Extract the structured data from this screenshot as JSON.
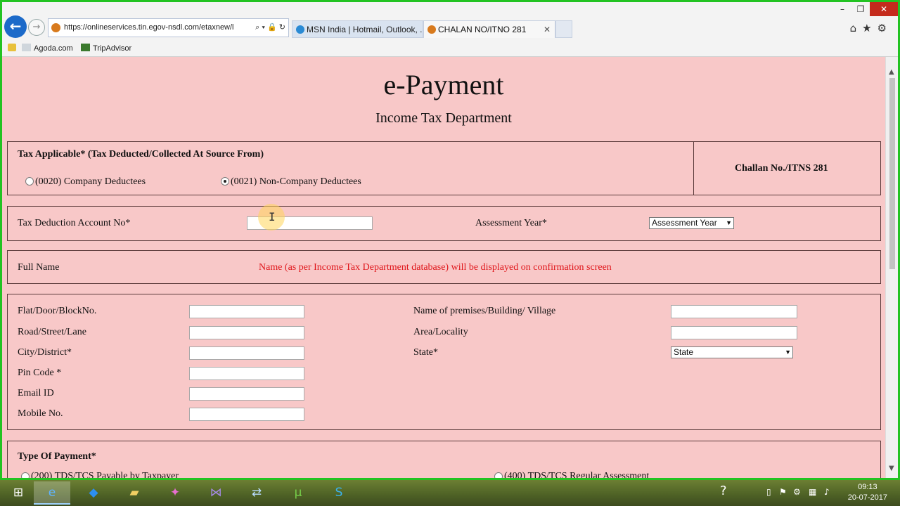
{
  "browser": {
    "address_url": "https://onlineservices.tin.egov-nsdl.com/etaxnew/l",
    "address_icons": "⌕ ▾ 🔒 ↻",
    "tabs": [
      {
        "label": "MSN India | Hotmail, Outlook, ..."
      },
      {
        "label": "CHALAN NO/ITNO 281"
      }
    ],
    "tab_close": "✕",
    "window_controls": {
      "minimize": "–",
      "restore": "❐",
      "close": "✕"
    },
    "right_icons": "⌂★⚙",
    "favorites": [
      {
        "label": "Agoda.com",
        "icon": "agoda-icon"
      },
      {
        "label": "TripAdvisor",
        "icon": "tripadvisor-icon"
      }
    ]
  },
  "page": {
    "title": "e-Payment",
    "subtitle": "Income Tax Department",
    "tax_applicable": {
      "heading": "Tax Applicable* (Tax Deducted/Collected At Source From)",
      "options": [
        {
          "label": "(0020) Company Deductees",
          "selected": false
        },
        {
          "label": "(0021) Non-Company Deductees",
          "selected": true
        }
      ],
      "challan": "Challan No./ITNS 281"
    },
    "tan": {
      "label": "Tax Deduction Account No*",
      "value": "",
      "assessment_label": "Assessment Year*",
      "assessment_value": "Assessment Year"
    },
    "full_name": {
      "label": "Full Name",
      "notice": "Name (as per Income Tax Department database) will be displayed on confirmation screen"
    },
    "address": {
      "left": [
        {
          "label": "Flat/Door/BlockNo.",
          "value": ""
        },
        {
          "label": "Road/Street/Lane",
          "value": ""
        },
        {
          "label": "City/District*",
          "value": ""
        },
        {
          "label": "Pin Code *",
          "value": ""
        },
        {
          "label": "Email ID",
          "value": ""
        },
        {
          "label": "Mobile No.",
          "value": ""
        }
      ],
      "right": [
        {
          "label": "Name of premises/Building/ Village",
          "value": ""
        },
        {
          "label": "Area/Locality",
          "value": ""
        },
        {
          "label": "State*",
          "value": "State"
        }
      ]
    },
    "payment_type": {
      "heading": "Type Of Payment*",
      "options": [
        {
          "label": "(200) TDS/TCS Payable by Taxpayer",
          "selected": false
        },
        {
          "label": "(400) TDS/TCS Regular Assessment",
          "selected": false
        }
      ]
    },
    "colors": {
      "background": "#f8c8c8",
      "notice": "#e0161b",
      "frame": "#22c322"
    }
  },
  "taskbar": {
    "apps": [
      {
        "name": "start",
        "icon": "windows-icon"
      },
      {
        "name": "internet-explorer",
        "icon": "ie-icon"
      },
      {
        "name": "dropbox",
        "icon": "dropbox-icon"
      },
      {
        "name": "file-explorer",
        "icon": "folder-icon"
      },
      {
        "name": "media-player",
        "icon": "media-icon"
      },
      {
        "name": "visual-studio",
        "icon": "vs-icon"
      },
      {
        "name": "network",
        "icon": "network-icon"
      },
      {
        "name": "utorrent",
        "icon": "utorrent-icon"
      },
      {
        "name": "skype",
        "icon": "skype-icon"
      }
    ],
    "time": "09:13",
    "date": "20-07-2017"
  }
}
